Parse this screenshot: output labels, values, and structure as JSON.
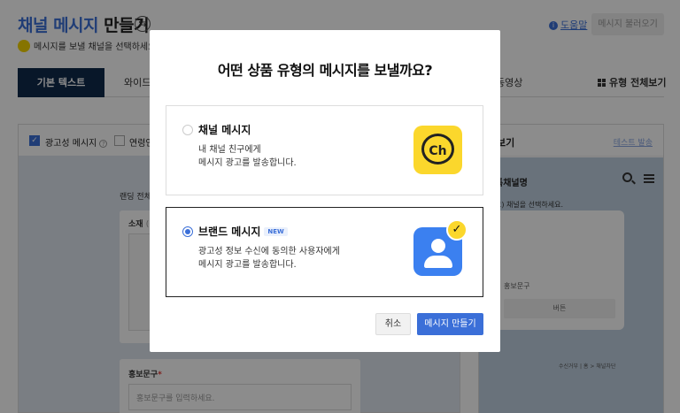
{
  "header": {
    "title_accent": "채널 메시지",
    "title_rest": " 만들기",
    "swap_symbol": "⇆",
    "help_label": "도움말",
    "info_symbol": "i",
    "load_button": "메시지 불러오기",
    "channel_placeholder": "메시지를 보낼 채널을 선택하세요.",
    "chevron": "⌄"
  },
  "tabs": {
    "basic_text": "기본 텍스트",
    "wide": "와이드 이",
    "video": "동영상",
    "all_types": "유형 전체보기"
  },
  "options": {
    "ad_message": "광고성 메시지",
    "age_label": "연령인",
    "check_mark": "✓",
    "question": "?"
  },
  "form": {
    "landing_label": "랜딩 전체",
    "material_label": "소재",
    "material_hint": "(선",
    "promo_label": "홍보문구",
    "promo_required": "*",
    "promo_placeholder": "홍보문구를 입력하세요."
  },
  "preview": {
    "title": "보기",
    "send_test": "테스트 발송",
    "channel_name": "톡채널명",
    "hint": "고) 채널을 선택하세요.",
    "promo_text": "홍보문구",
    "button_text": "버튼",
    "footer": "수신거부 | 홈 > 채널차단"
  },
  "modal": {
    "title": "어떤 상품 유형의 메시지를 보낼까요?",
    "options": [
      {
        "title": "채널 메시지",
        "desc_line1": "내 채널 친구에게",
        "desc_line2": "메시지 광고를 발송합니다.",
        "logo_text": "Ch",
        "selected": false
      },
      {
        "title": "브랜드 메시지",
        "badge": "NEW",
        "desc_line1": "광고성 정보 수신에 동의한 사용자에게",
        "desc_line2": "메시지 광고를 발송합니다.",
        "check_symbol": "✓",
        "selected": true
      }
    ],
    "cancel_label": "취소",
    "create_label": "메시지 만들기"
  },
  "colors": {
    "accent": "#3b6fd8",
    "nav_dark": "#0f2a4b",
    "kakao_yellow": "#fbd72c",
    "brand_blue": "#3b80f0"
  }
}
